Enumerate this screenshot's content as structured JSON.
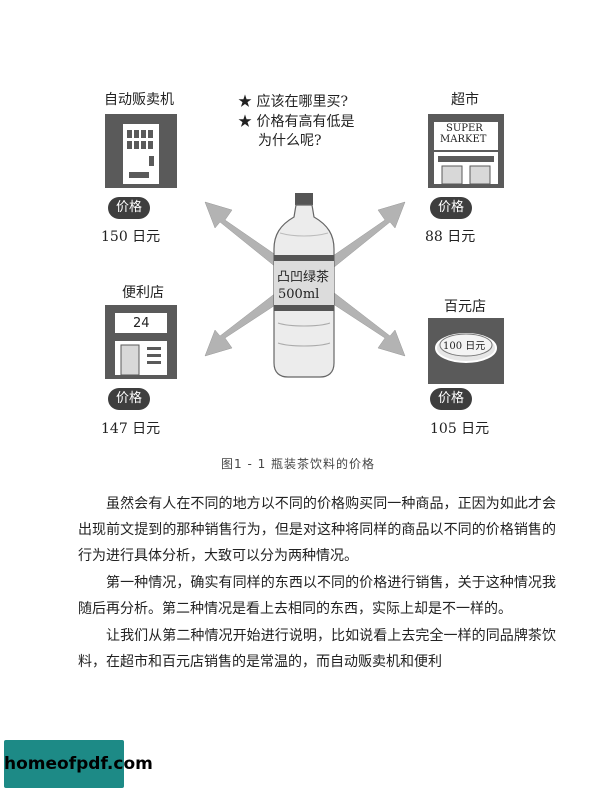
{
  "figure": {
    "questions": [
      "★ 应该在哪里买?",
      "★ 价格有高有低是",
      "为什么呢?"
    ],
    "bottle_label_line1": "凸凹绿茶",
    "bottle_label_line2": "500ml",
    "vending": {
      "name": "自动贩卖机",
      "price_badge": "价格",
      "price": "150 日元"
    },
    "supermarket": {
      "name": "超市",
      "sign_line1": "SUPER",
      "sign_line2": "MARKET",
      "price_badge": "价格",
      "price": "88 日元"
    },
    "convenience": {
      "name": "便利店",
      "sign": "24",
      "price_badge": "价格",
      "price": "147 日元"
    },
    "hundred_yen": {
      "name": "百元店",
      "coin_text": "100 日元",
      "price_badge": "价格",
      "price": "105 日元"
    },
    "caption": "图1 - 1 瓶装茶饮料的价格"
  },
  "body_text": [
    "虽然会有人在不同的地方以不同的价格购买同一种商品，正因为如此才会出现前文提到的那种销售行为，但是对这种将同样的商品以不同的价格销售的行为进行具体分析，大致可以分为两种情况。",
    "第一种情况，确实有同样的东西以不同的价格进行销售，关于这种情况我随后再分析。第二种情况是看上去相同的东西，实际上却是不一样的。",
    "让我们从第二种情况开始进行说明，比如说看上去完全一样的同品牌茶饮料，在超市和百元店销售的是常温的，而自动贩卖机和便利"
  ],
  "watermark": "homeofpdf.com",
  "colors": {
    "icon_bg": "#5a5a5a",
    "pill_bg": "#3e3e3e",
    "arrow": "#aaaaaa",
    "watermark_bg": "#1d8a86"
  }
}
